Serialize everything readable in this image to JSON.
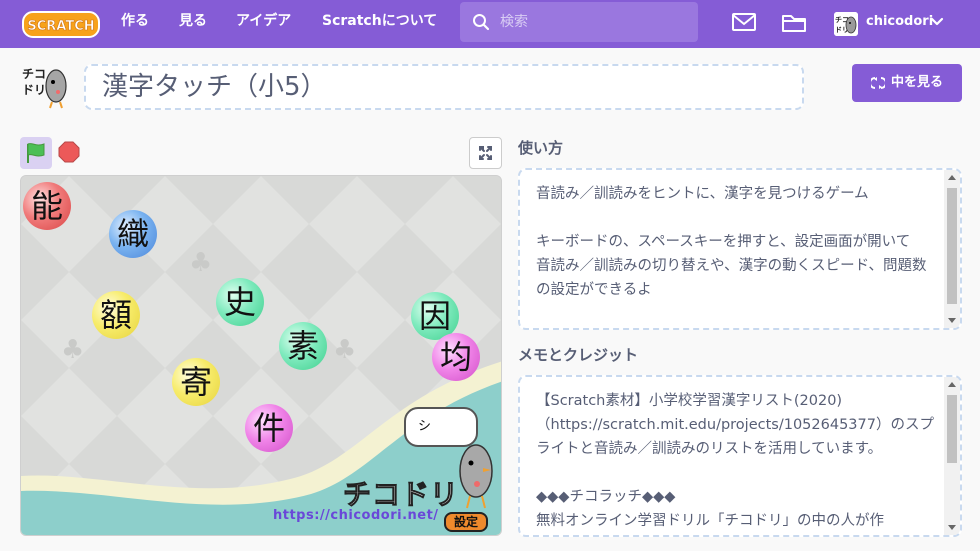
{
  "nav": {
    "logo_text": "SCRATCH",
    "menu": [
      "作る",
      "見る",
      "アイデア",
      "Scratchについて"
    ],
    "search_placeholder": "検索",
    "username": "chicodori"
  },
  "project": {
    "title": "漢字タッチ（小5）",
    "see_inside_label": "中を見る"
  },
  "stage": {
    "kanji": [
      "能",
      "織",
      "額",
      "史",
      "素",
      "因",
      "均",
      "寄",
      "件"
    ],
    "speech_text": "シ",
    "brand": "チコドリ",
    "url": "https://chicodori.net/",
    "settings_label": "設定"
  },
  "instructions": {
    "heading": "使い方",
    "text": "音読み／訓読みをヒントに、漢字を見つけるゲーム\n\nキーボードの、スペースキーを押すと、設定画面が開いて\n音読み／訓読みの切り替えや、漢字の動くスピード、問題数の設定ができるよ"
  },
  "notes": {
    "heading": "メモとクレジット",
    "text": "【Scratch素材】小学校学習漢字リスト(2020)\n（https://scratch.mit.edu/projects/1052645377）のスプライトと音読み／訓読みのリストを活用しています。\n\n◆◆◆チコラッチ◆◆◆\n無料オンライン学習ドリル「チコドリ」の中の人が作"
  },
  "colors": {
    "accent": "#855cd6",
    "text": "#575e75",
    "stop": "#ec5959",
    "flag": "#4cbf56"
  }
}
